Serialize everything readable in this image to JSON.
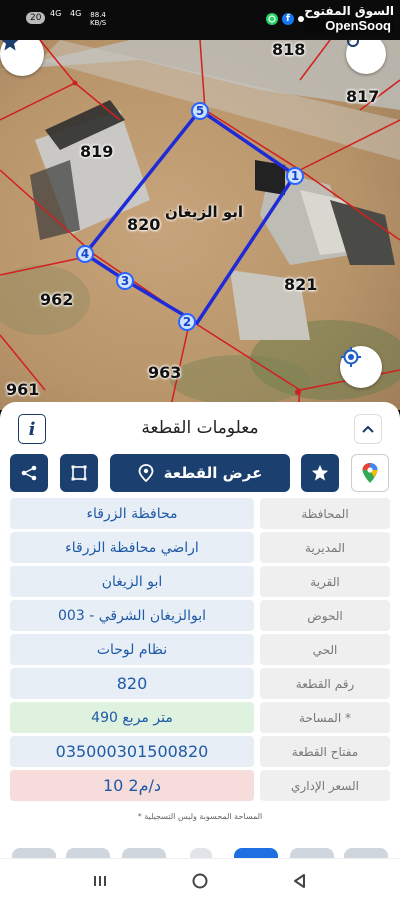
{
  "status_bar": {
    "time": "",
    "pill": "20",
    "network_a": "4G",
    "network_b": "4G",
    "speed_value": "88.4",
    "speed_unit": "KB/S",
    "icons": [
      "whatsapp-icon",
      "facebook-icon",
      "notification-dot-icon"
    ]
  },
  "brand": {
    "arabic": "السوق المفتوح",
    "english": "OpenSooq"
  },
  "map": {
    "selected_plot_number": "820",
    "selected_plot_village": "ابو الزيغان",
    "vertices": [
      "1",
      "2",
      "3",
      "4",
      "5"
    ],
    "neighbor_plots": [
      "818",
      "817",
      "819",
      "821",
      "962",
      "963",
      "961"
    ],
    "colors": {
      "parcel_boundary": "#d21f1f",
      "selected_plot": "#1f2bd6",
      "vertex_fill": "#cfe2ff"
    }
  },
  "panel": {
    "title": "معلومات القطعة",
    "info_label": "i",
    "show_plot_label": "عرض القطعة",
    "rows": [
      {
        "label": "المحافظة",
        "value": "محافظة الزرقاء",
        "style": "normal"
      },
      {
        "label": "المديرية",
        "value": "اراضي محافظة الزرقاء",
        "style": "normal"
      },
      {
        "label": "القرية",
        "value": "ابو الزيغان",
        "style": "normal"
      },
      {
        "label": "الحوض",
        "value": "ابوالزيغان الشرقي - 003",
        "style": "normal"
      },
      {
        "label": "الحي",
        "value": "نظام لوحات",
        "style": "normal"
      },
      {
        "label": "رقم القطعة",
        "value": "820",
        "style": "big"
      },
      {
        "label": "المساحة *",
        "value": "490 متر مربع",
        "style": "green"
      },
      {
        "label": "مفتاح القطعة",
        "value": "035000301500820",
        "style": "big"
      },
      {
        "label": "السعر الإداري",
        "value": "10 د/م2",
        "style": "red"
      }
    ],
    "footnote": "* المساحة المحسوبة وليس التسجيلية",
    "colors": {
      "primary": "#1b3f6e",
      "value_text": "#1f5aa6",
      "value_bg": "#e8eef6",
      "area_bg": "#dff2df",
      "price_bg": "#f7dcdc"
    }
  }
}
